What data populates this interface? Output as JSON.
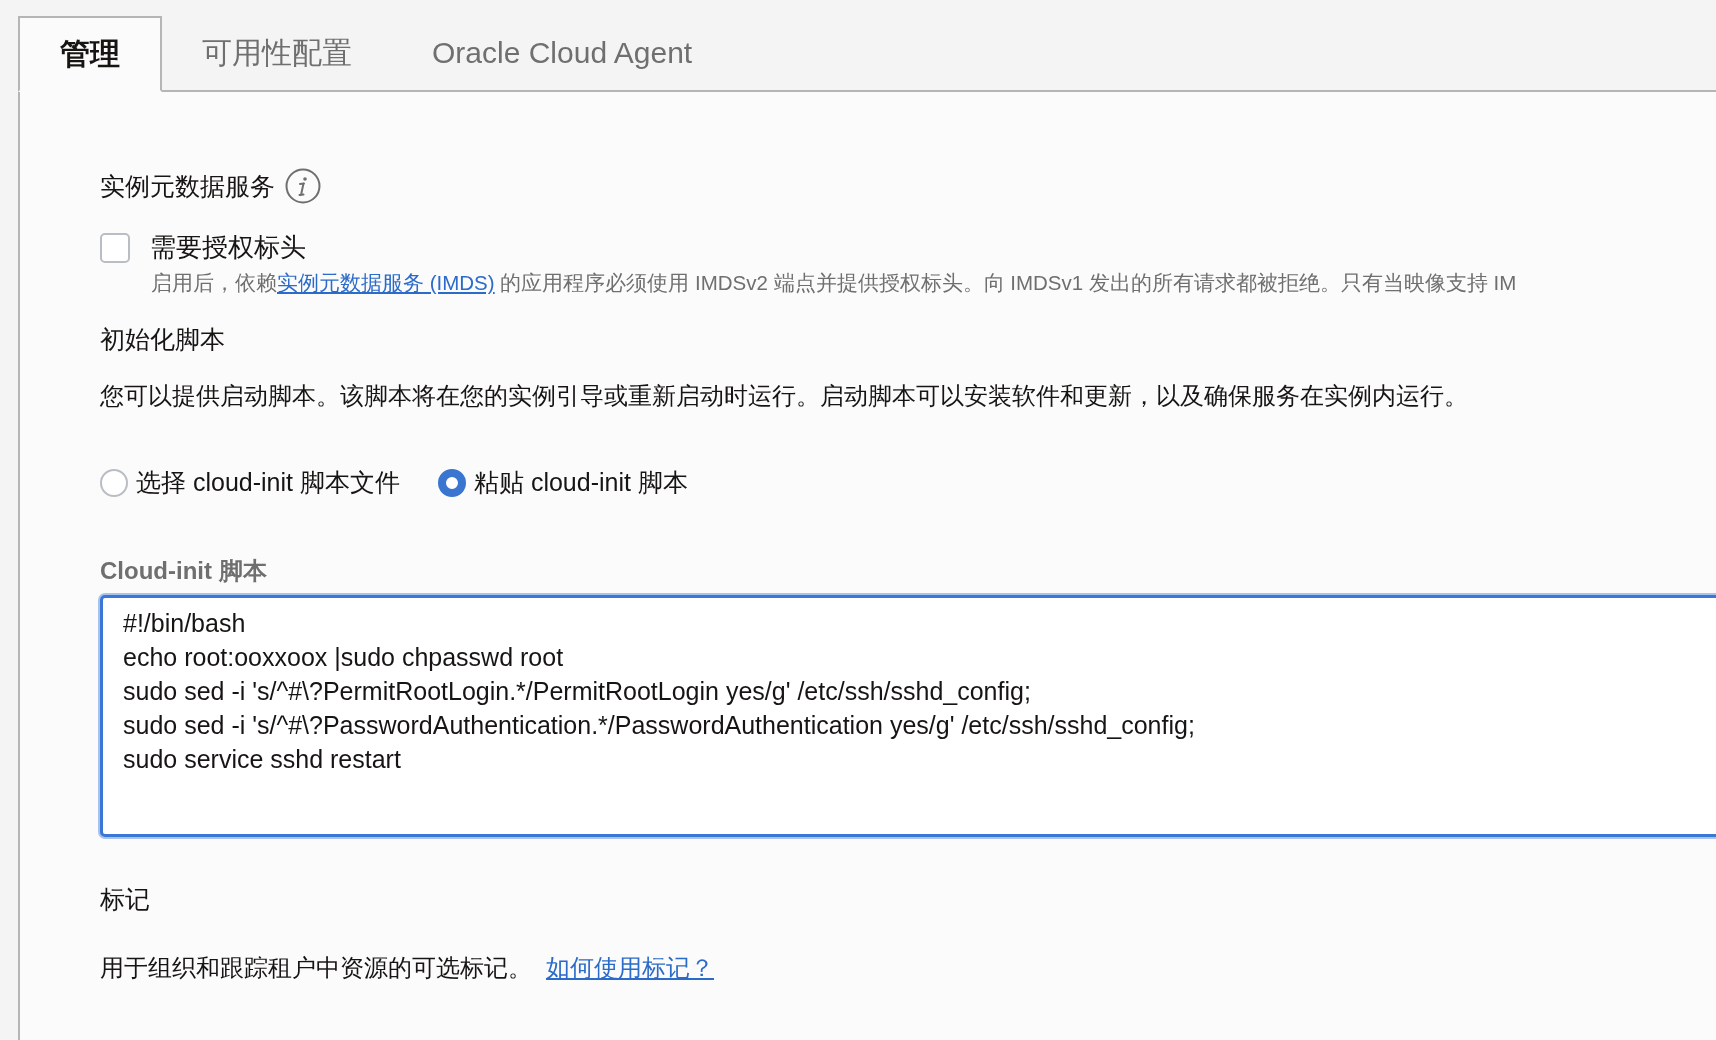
{
  "tabs": [
    {
      "label": "管理",
      "selected": true
    },
    {
      "label": "可用性配置",
      "selected": false
    },
    {
      "label": "Oracle Cloud Agent",
      "selected": false
    }
  ],
  "metadata_service": {
    "title": "实例元数据服务",
    "checkbox": {
      "label": "需要授权标头",
      "checked": false
    },
    "help_before": "启用后，依赖",
    "help_link": "实例元数据服务 (IMDS)",
    "help_after": " 的应用程序必须使用 IMDSv2 端点并提供授权标头。向 IMDSv1 发出的所有请求都被拒绝。只有当映像支持 IM"
  },
  "init_script": {
    "title": "初始化脚本",
    "description": "您可以提供启动脚本。该脚本将在您的实例引导或重新启动时运行。启动脚本可以安装软件和更新，以及确保服务在实例内运行。",
    "options": [
      {
        "label": "选择 cloud-init 脚本文件",
        "selected": false
      },
      {
        "label": "粘贴 cloud-init 脚本",
        "selected": true
      }
    ],
    "field_label": "Cloud-init 脚本",
    "lines": [
      "#!/bin/bash",
      "echo root:ooxxoox |sudo chpasswd root",
      "sudo sed -i 's/^#\\?PermitRootLogin.*/PermitRootLogin yes/g' /etc/ssh/sshd_config;",
      "sudo sed -i 's/^#\\?PasswordAuthentication.*/PasswordAuthentication yes/g' /etc/ssh/sshd_config;",
      "sudo service sshd restart"
    ]
  },
  "tags": {
    "title": "标记",
    "description": "用于组织和跟踪租户中资源的可选标记。",
    "link": "如何使用标记？"
  }
}
